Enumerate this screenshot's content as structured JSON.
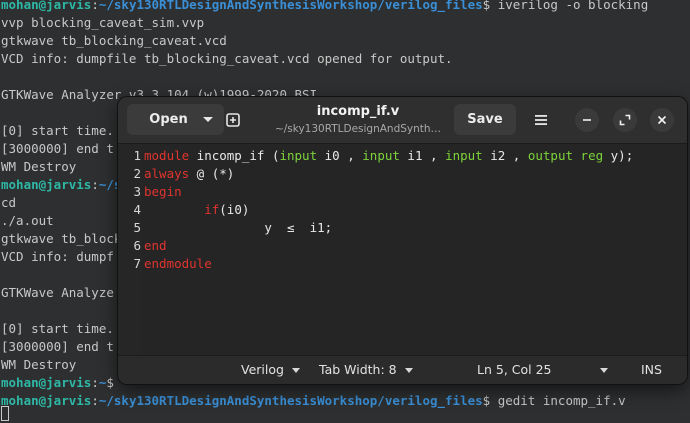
{
  "terminal": {
    "lines_top": [
      {
        "prompt_user": "mohan@jarvis",
        "prompt_sep": ":",
        "prompt_path": "~/sky130RTLDesignAndSynthesisWorkshop/verilog_files",
        "prompt_end": "$ ",
        "command": "iverilog -o blocking"
      },
      {
        "text": "vvp blocking_caveat_sim.vvp"
      },
      {
        "text": "gtkwave tb_blocking_caveat.vcd"
      },
      {
        "text": "VCD info: dumpfile tb_blocking_caveat.vcd opened for output."
      },
      {
        "text": ""
      },
      {
        "text": "GTKWave Analyzer v3.3.104 (w)1999-2020 BSI"
      },
      {
        "text": ""
      },
      {
        "text": "[0] start time."
      },
      {
        "text": "[3000000] end t"
      },
      {
        "text": "WM Destroy"
      },
      {
        "prompt_user": "mohan@jarvis",
        "prompt_sep": ":",
        "prompt_path": "~/sky130RTLDesignAndSynthesisWorkshop/verilog_files",
        "prompt_end": "$ ",
        "command": ""
      },
      {
        "text": "cd"
      },
      {
        "text": "./a.out"
      },
      {
        "text": "gtkwave tb_block"
      },
      {
        "text": "VCD info: dumpf"
      },
      {
        "text": ""
      },
      {
        "text": "GTKWave Analyze"
      },
      {
        "text": ""
      },
      {
        "text": "[0] start time."
      },
      {
        "text": "[3000000] end t"
      },
      {
        "text": "WM Destroy"
      },
      {
        "prompt_user": "mohan@jarvis",
        "prompt_sep": ":",
        "prompt_path": "~",
        "prompt_end": "$ ",
        "command": ""
      },
      {
        "prompt_user": "mohan@jarvis",
        "prompt_sep": ":",
        "prompt_path": "~/sky130RTLDesignAndSynthesisWorkshop/verilog_files",
        "prompt_end": "$ ",
        "command": "gedit incomp_if.v"
      }
    ]
  },
  "gedit": {
    "open_label": "Open",
    "title": "incomp_if.v",
    "subtitle": "~/sky130RTLDesignAndSynth…",
    "save_label": "Save",
    "line_numbers": [
      "1",
      "2",
      "3",
      "4",
      "5",
      "6",
      "7"
    ],
    "code_lines": [
      [
        {
          "t": "module",
          "c": "kw"
        },
        {
          "t": " incomp_if (",
          "c": "pl"
        },
        {
          "t": "input",
          "c": "ty"
        },
        {
          "t": " i0 , ",
          "c": "pl"
        },
        {
          "t": "input",
          "c": "ty"
        },
        {
          "t": " i1 , ",
          "c": "pl"
        },
        {
          "t": "input",
          "c": "ty"
        },
        {
          "t": " i2 , ",
          "c": "pl"
        },
        {
          "t": "output reg",
          "c": "ty"
        },
        {
          "t": " y);",
          "c": "pl"
        }
      ],
      [
        {
          "t": "always",
          "c": "kw"
        },
        {
          "t": " @ (*)",
          "c": "pl"
        }
      ],
      [
        {
          "t": "begin",
          "c": "kw"
        }
      ],
      [
        {
          "t": "        ",
          "c": "pl"
        },
        {
          "t": "if",
          "c": "kw"
        },
        {
          "t": "(i0)",
          "c": "pl"
        }
      ],
      [
        {
          "t": "                y  ≤  i1;",
          "c": "pl"
        }
      ],
      [
        {
          "t": "end",
          "c": "kw"
        }
      ],
      [
        {
          "t": "endmodule",
          "c": "kw"
        }
      ]
    ],
    "status": {
      "language": "Verilog",
      "tab_width": "Tab Width: 8",
      "position": "Ln 5, Col 25",
      "mode": "INS"
    }
  },
  "colors": {
    "keyword": "#e0342f",
    "type": "#7dd33a",
    "prompt_user": "#2eb8a6",
    "prompt_path": "#3a8fd6"
  },
  "icons": [
    "new-tab-icon",
    "hamburger-menu-icon",
    "minimize-icon",
    "maximize-icon",
    "close-icon",
    "chevron-down-icon"
  ]
}
